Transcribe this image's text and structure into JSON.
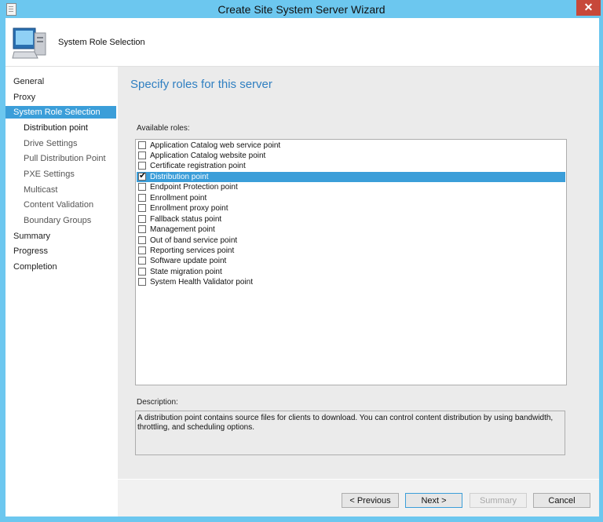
{
  "window": {
    "title": "Create Site System Server Wizard",
    "close_label": "✕"
  },
  "header": {
    "title": "System Role Selection",
    "icon": "computer-icon"
  },
  "nav": {
    "items": [
      {
        "label": "General",
        "level": 0,
        "state": "normal"
      },
      {
        "label": "Proxy",
        "level": 0,
        "state": "normal"
      },
      {
        "label": "System Role Selection",
        "level": 0,
        "state": "selected"
      },
      {
        "label": "Distribution point",
        "level": 1,
        "state": "current"
      },
      {
        "label": "Drive Settings",
        "level": 1,
        "state": "normal"
      },
      {
        "label": "Pull Distribution Point",
        "level": 1,
        "state": "normal"
      },
      {
        "label": "PXE Settings",
        "level": 1,
        "state": "normal"
      },
      {
        "label": "Multicast",
        "level": 1,
        "state": "normal"
      },
      {
        "label": "Content Validation",
        "level": 1,
        "state": "normal"
      },
      {
        "label": "Boundary Groups",
        "level": 1,
        "state": "normal"
      },
      {
        "label": "Summary",
        "level": 0,
        "state": "normal"
      },
      {
        "label": "Progress",
        "level": 0,
        "state": "normal"
      },
      {
        "label": "Completion",
        "level": 0,
        "state": "normal"
      }
    ]
  },
  "main": {
    "heading": "Specify roles for this server",
    "available_roles_label": "Available roles:",
    "roles": [
      {
        "label": "Application Catalog web service point",
        "checked": false,
        "selected": false
      },
      {
        "label": "Application Catalog website point",
        "checked": false,
        "selected": false
      },
      {
        "label": "Certificate registration point",
        "checked": false,
        "selected": false
      },
      {
        "label": "Distribution point",
        "checked": true,
        "selected": true
      },
      {
        "label": "Endpoint Protection point",
        "checked": false,
        "selected": false
      },
      {
        "label": "Enrollment point",
        "checked": false,
        "selected": false
      },
      {
        "label": "Enrollment proxy point",
        "checked": false,
        "selected": false
      },
      {
        "label": "Fallback status point",
        "checked": false,
        "selected": false
      },
      {
        "label": "Management point",
        "checked": false,
        "selected": false
      },
      {
        "label": "Out of band service point",
        "checked": false,
        "selected": false
      },
      {
        "label": "Reporting services point",
        "checked": false,
        "selected": false
      },
      {
        "label": "Software update point",
        "checked": false,
        "selected": false
      },
      {
        "label": "State migration point",
        "checked": false,
        "selected": false
      },
      {
        "label": "System Health Validator point",
        "checked": false,
        "selected": false
      }
    ],
    "description_label": "Description:",
    "description_text": "A distribution point contains source files for clients to download. You can control content distribution by using bandwidth, throttling, and scheduling options."
  },
  "buttons": {
    "previous": "< Previous",
    "next": "Next >",
    "summary": "Summary",
    "cancel": "Cancel"
  },
  "colors": {
    "accent": "#3b9ed9",
    "title_bar": "#6cc7ef",
    "close": "#c7483a",
    "heading": "#2f7fc1"
  }
}
